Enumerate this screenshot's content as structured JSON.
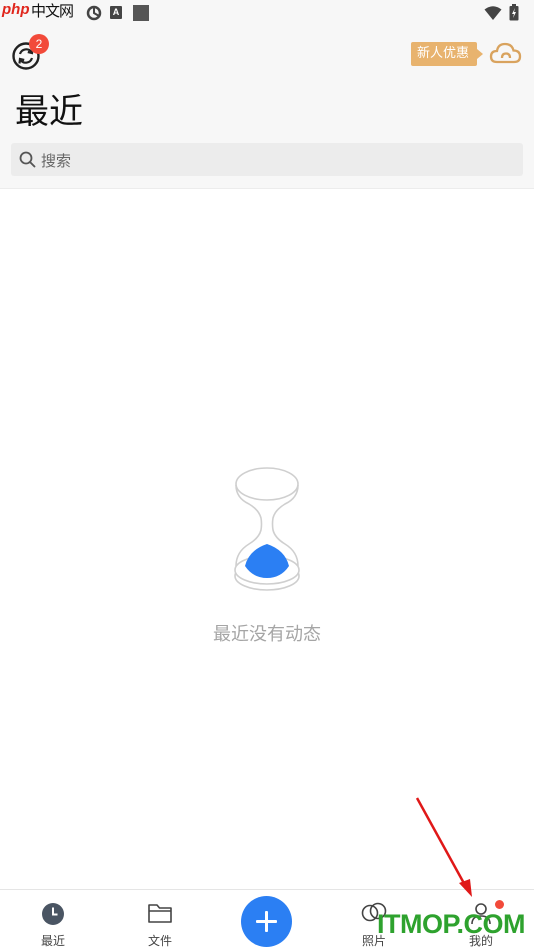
{
  "watermarks": {
    "top_left_brand": "php",
    "top_left_text": "中文网",
    "bottom_right": "ITMOP.COM"
  },
  "status_bar": {
    "icons": [
      "a-icon",
      "square-icon",
      "wifi-icon",
      "battery-icon"
    ],
    "a_label": "A"
  },
  "header": {
    "sync_badge_count": "2",
    "promo_label": "新人优惠",
    "title": "最近",
    "search_placeholder": "搜索"
  },
  "empty_state": {
    "message": "最近没有动态",
    "accent_color": "#2b7ff3"
  },
  "bottom_nav": {
    "items": [
      {
        "label": "最近",
        "icon": "clock-icon",
        "selected": true
      },
      {
        "label": "文件",
        "icon": "folder-icon",
        "selected": false
      },
      {
        "label": "",
        "icon": "plus-icon",
        "selected": false
      },
      {
        "label": "照片",
        "icon": "photo-icon",
        "selected": false
      },
      {
        "label": "我的",
        "icon": "person-icon",
        "selected": false
      }
    ],
    "mine_has_notification": true
  },
  "colors": {
    "brand_blue": "#2b7ff3",
    "badge_red": "#f24a3a",
    "promo_gold": "#e8b36e"
  }
}
